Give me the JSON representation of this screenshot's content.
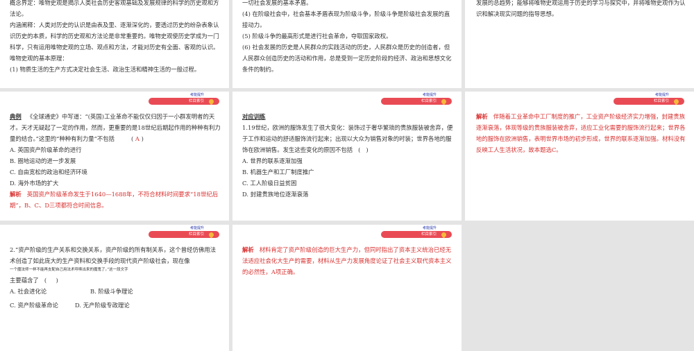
{
  "common": {
    "tag": "考能提升",
    "pill": "栏目索引"
  },
  "s1": {
    "lines": [
      "概念界定：唯物史观是揭示人类社会历史客观基础及发展规律的科学的历史观和方法论。",
      "内涵阐释：人类对历史的认识是由表及里、逐渐深化的，要透过历史的纷杂表象认识历史的本质，科学的历史观和方法论是非常重要的。唯物史观使历史学成为一门科学，只有运用唯物史观的立场、观点和方法，才能对历史有全面、客观的认识。唯物史观的基本原理：",
      "(1) 物质生活的生产方式决定社会生活、政治生活和精神生活的一般过程。"
    ]
  },
  "s2": {
    "lines": [
      "一切社会发展的基本矛盾。",
      "(4) 在阶级社会中，社会基本矛盾表现为阶级斗争，阶级斗争是阶级社会发展的直接动力。",
      "(5) 阶级斗争的最高形式是进行社会革命，夺取国家政权。",
      "(6) 社会发展的历史是人民群众的实践活动的历史，人民群众是历史的创造者，但人民群众创造历史的活动和作用，总是受到一定历史阶段的经济、政治和思想文化条件的制约。"
    ]
  },
  "s3": {
    "lines": [
      "发展的总趋势；能够将唯物史观运用于历史的学习与探究中，并将唯物史观作为认识和解决现实问题的指导思想。"
    ]
  },
  "s4": {
    "label": "典例",
    "question": "《全球通史》中写道：“(英国)工业革命不能仅仅归因于一小群发明者的天才。天才无疑起了一定的作用，然而，更重要的是18世纪后期起作用的种种有利力量的结合。”这里的“种种有利力量”不包括",
    "answer": "A",
    "options": [
      "A. 英国资产阶级革命的进行",
      "B. 圈地运动的进一步发展",
      "C. 自由宽松的政治和经济环境",
      "D. 海外市场的扩大"
    ],
    "analysis_label": "解析",
    "analysis": "英国资产阶级革命发生于1640—1688年，不符合材料时间要求“18世纪后期”，B、C、D三项都符合时间信息。"
  },
  "s5": {
    "label": "对应训练",
    "question": "1.19世纪，欧洲的服饰发生了很大变化：装饰过于奢华繁琐的贵族服装被舍弃，便于工作和运动的舒适服饰流行起来；出现以大众为销售对象的时装；世界各地的服饰在欧洲销售。发生这些变化的原因不包括",
    "options": [
      "A. 世界的联系逐渐加强",
      "B. 机器生产和工厂制度推广",
      "C. 工人阶级日益贫困",
      "D. 封建贵族地位逐渐衰落"
    ]
  },
  "s6": {
    "analysis_label": "解析",
    "analysis": "伴随着工业革命中工厂制度的推广，工业资产阶级经济实力增强，封建贵族逐渐衰落，体现等级的贵族服装被舍弃，适应工业化需要的服饰流行起来；世界各地的服饰在欧洲销售，表明世界市场的初步形成，世界的联系逐渐加强。材料没有反映工人生活状况，故本题选C。"
  },
  "s7": {
    "question": "2.“资产阶级的生产关系和交换关系，资产阶级的所有制关系，这个曾经仿佛用法术创造了如此庞大的生产资料和交换手段的现代资产阶级社会，现在像",
    "small": "一个魔法师一样不能再支配自己用法术呼唤出来的魔鬼了。”这一段文字",
    "tail": "主要蕴含了",
    "options": [
      "A. 社会进化论",
      "B. 阶级斗争理论",
      "C. 资产阶级革命论",
      "D. 无产阶级专政理论"
    ]
  },
  "s8": {
    "analysis_label": "解析",
    "analysis": "材料肯定了资产阶级创造的巨大生产力，但同时指出了资本主义统治已经无法适应社会化大生产的需要，材料从生产力发展角度论证了社会主义取代资本主义的必然性，A项正确。"
  }
}
